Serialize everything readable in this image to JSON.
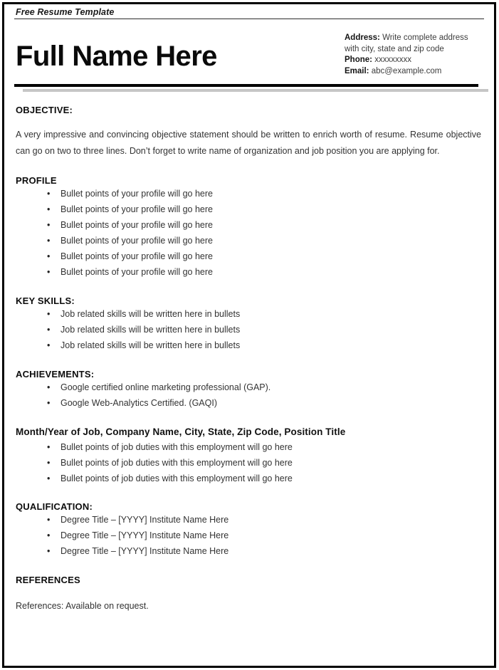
{
  "document": {
    "label": "Free Resume Template"
  },
  "header": {
    "full_name": "Full Name Here",
    "contact": {
      "address_label": "Address:",
      "address_value": "Write complete address with city, state and zip code",
      "phone_label": "Phone:",
      "phone_value": "xxxxxxxxx",
      "email_label": "Email:",
      "email_value": "abc@example.com"
    }
  },
  "sections": {
    "objective": {
      "heading": "OBJECTIVE:",
      "text": "A very impressive and convincing objective statement should be written to enrich worth of resume. Resume objective can go on two to three lines. Don’t forget to write name of organization and job position you are applying for."
    },
    "profile": {
      "heading": "PROFILE",
      "items": [
        "Bullet points of your profile will go here",
        "Bullet points of your profile will go here",
        "Bullet points of your profile will go here",
        "Bullet points of your profile will go here",
        "Bullet points of your profile will go here",
        "Bullet points of your profile will go here"
      ]
    },
    "key_skills": {
      "heading": "KEY SKILLS:",
      "items": [
        "Job related skills will be written here in bullets",
        "Job related skills will be written here in bullets",
        "Job related skills will be written here in bullets"
      ]
    },
    "achievements": {
      "heading": "ACHIEVEMENTS:",
      "items": [
        "Google certified online marketing professional (GAP).",
        "Google Web-Analytics Certified. (GAQI)"
      ]
    },
    "experience": {
      "lead": "Month/Year of Job, Company Name, City, State, Zip Code, Position Title",
      "items": [
        "Bullet points of job duties with this employment will go here",
        "Bullet points of job duties with this employment will go here",
        "Bullet points of job duties with this employment will go here"
      ]
    },
    "qualification": {
      "heading": "QUALIFICATION:",
      "items": [
        "Degree Title – [YYYY] Institute Name Here",
        "Degree Title – [YYYY] Institute Name Here",
        "Degree Title – [YYYY] Institute Name Here"
      ]
    },
    "references": {
      "heading": "REFERENCES",
      "text": "References: Available on request."
    }
  },
  "bullet_glyph": "•",
  "colors": {
    "text": "#333333",
    "heading": "#0d0d0d",
    "rule_dark": "#000000",
    "rule_light": "#c6c6c6",
    "border": "#000000"
  }
}
